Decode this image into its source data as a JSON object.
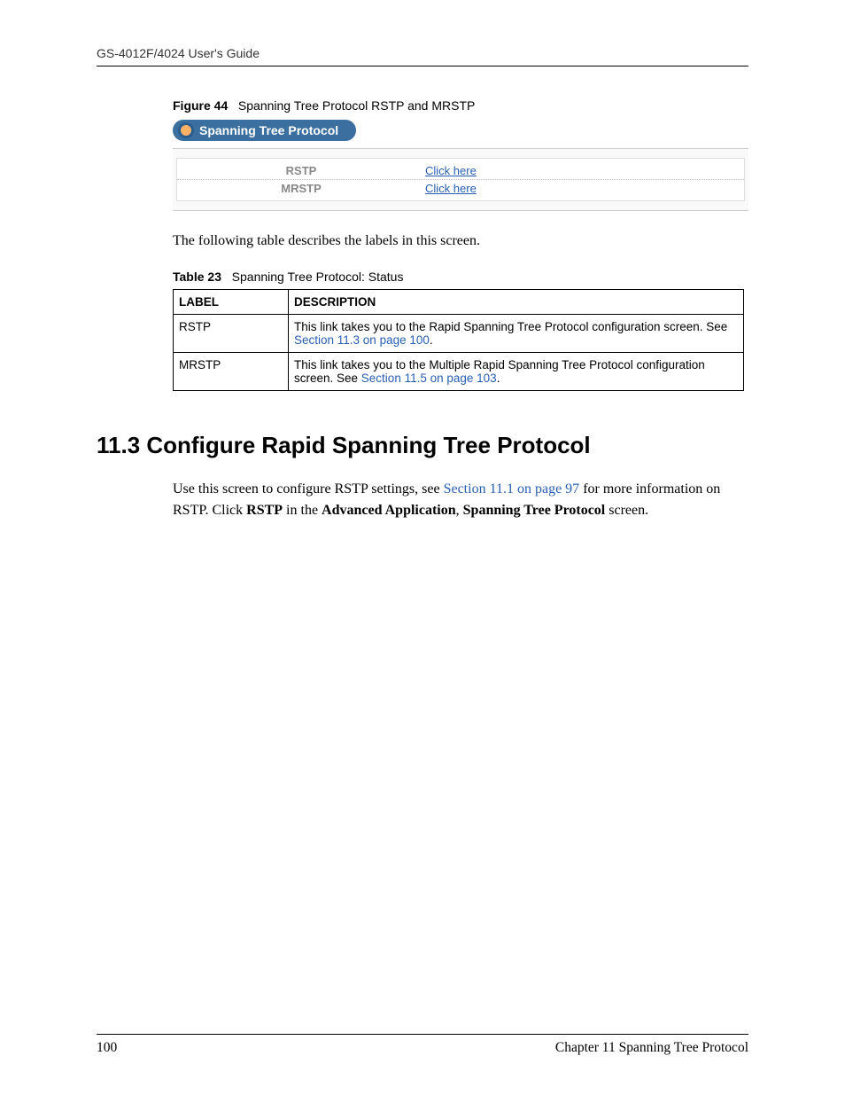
{
  "header": {
    "guide_title": "GS-4012F/4024 User's Guide"
  },
  "figure": {
    "label": "Figure 44",
    "caption": "Spanning Tree Protocol RSTP and MRSTP"
  },
  "screenshot": {
    "panel_title": "Spanning Tree Protocol",
    "rows": [
      {
        "label": "RSTP",
        "link_text": "Click here"
      },
      {
        "label": "MRSTP",
        "link_text": "Click here"
      }
    ]
  },
  "intro_text": "The following table describes the labels in this screen.",
  "table": {
    "label": "Table 23",
    "caption": "Spanning Tree Protocol: Status",
    "headers": {
      "col1": "LABEL",
      "col2": "DESCRIPTION"
    },
    "rows": [
      {
        "label": "RSTP",
        "desc_pre": "This link takes you to the Rapid Spanning Tree Protocol configuration screen. See ",
        "desc_link": "Section 11.3 on page 100",
        "desc_post": "."
      },
      {
        "label": "MRSTP",
        "desc_pre": "This link takes you to the Multiple Rapid Spanning Tree Protocol configuration screen. See ",
        "desc_link": "Section 11.5 on page 103",
        "desc_post": "."
      }
    ]
  },
  "section": {
    "heading": "11.3  Configure Rapid Spanning Tree Protocol",
    "p1_pre": "Use this screen to configure RSTP settings, see ",
    "p1_link": "Section 11.1 on page 97",
    "p1_mid": " for more information on RSTP. Click ",
    "p1_b1": "RSTP",
    "p1_mid2": " in the ",
    "p1_b2": "Advanced Application",
    "p1_comma": ", ",
    "p1_b3": "Spanning Tree Protocol",
    "p1_end": " screen."
  },
  "footer": {
    "page_number": "100",
    "chapter": "Chapter 11 Spanning Tree Protocol"
  }
}
